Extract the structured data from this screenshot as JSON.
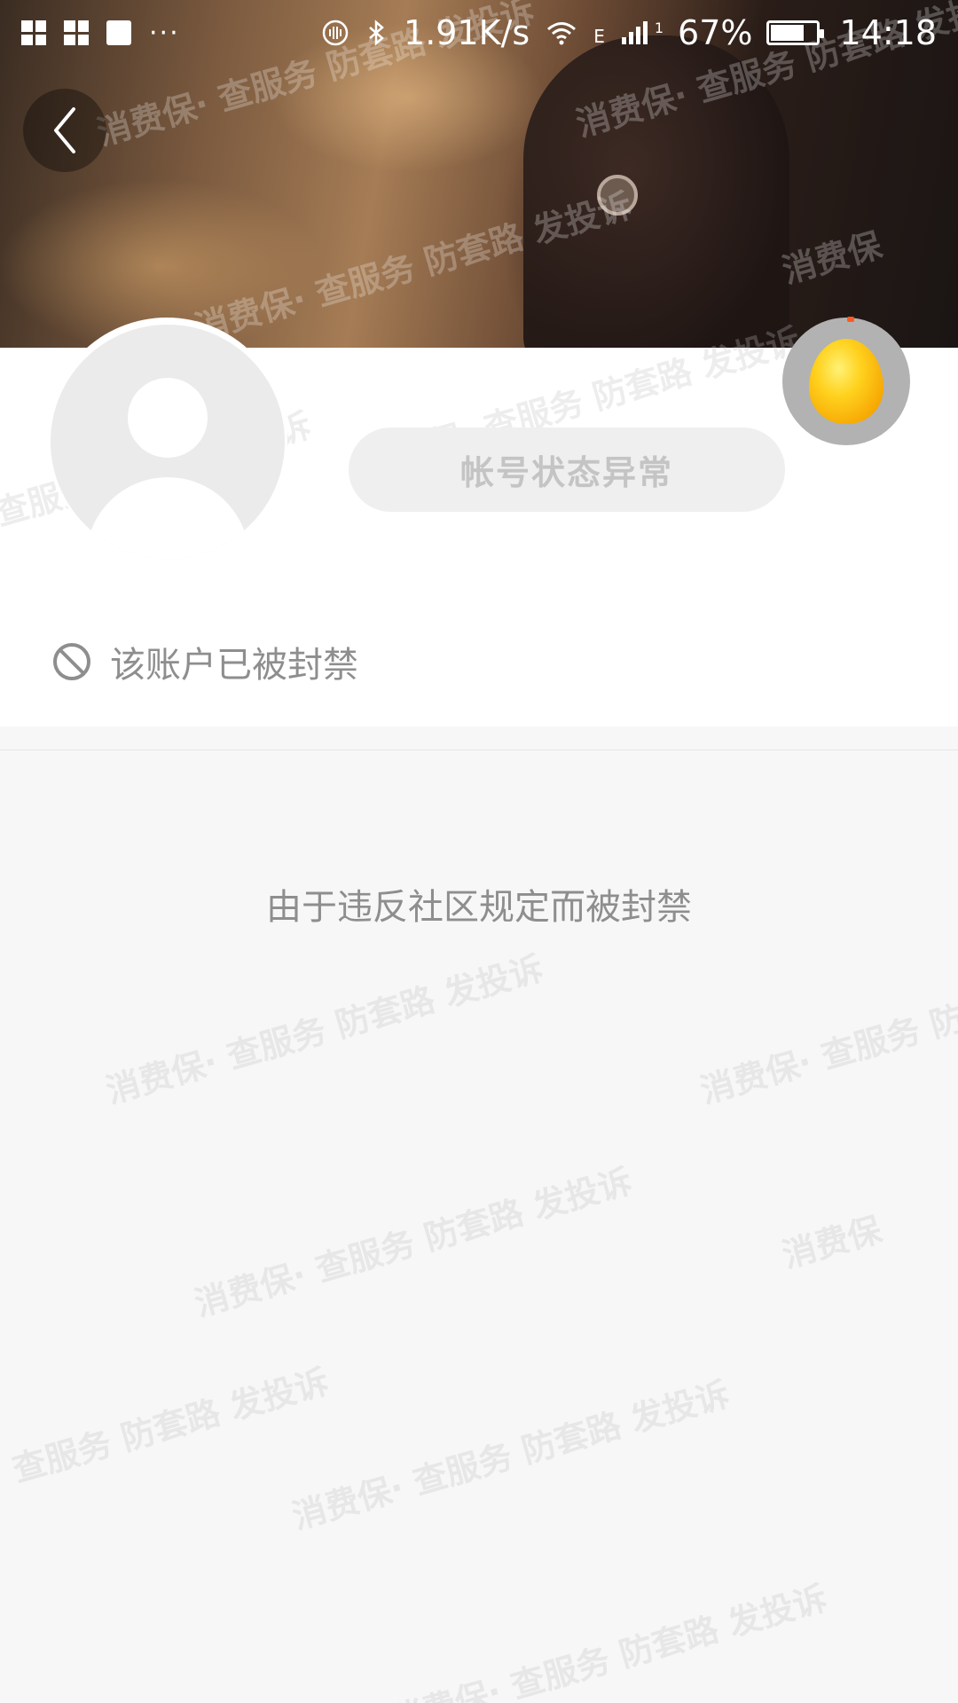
{
  "status_bar": {
    "speed": "1.91K/s",
    "network_type": "E",
    "sim_slot": "1",
    "battery_percent": "67%",
    "battery_level": 0.67,
    "time": "14:18",
    "icons": [
      "app-grid-icon",
      "app-grid-icon",
      "image-icon",
      "more-dots-icon",
      "nfc-icon",
      "bluetooth-icon",
      "wifi-icon",
      "signal-icon",
      "battery-icon"
    ]
  },
  "header": {
    "back_icon": "chevron-left-icon"
  },
  "profile": {
    "status_label": "帐号状态异常",
    "banned_text": "该账户已被封禁",
    "banned_icon": "ban-icon",
    "egg_icon": "golden-egg-icon"
  },
  "main": {
    "reason_text": "由于违反社区规定而被封禁"
  },
  "watermark": {
    "brand": "消费保",
    "slogan": "· 查服务 防套路 发投诉"
  },
  "colors": {
    "text_gray": "#8e8e8e",
    "pill_bg": "#efefef",
    "page_bg": "#f7f7f7",
    "accent_red": "#ff5a1f"
  }
}
